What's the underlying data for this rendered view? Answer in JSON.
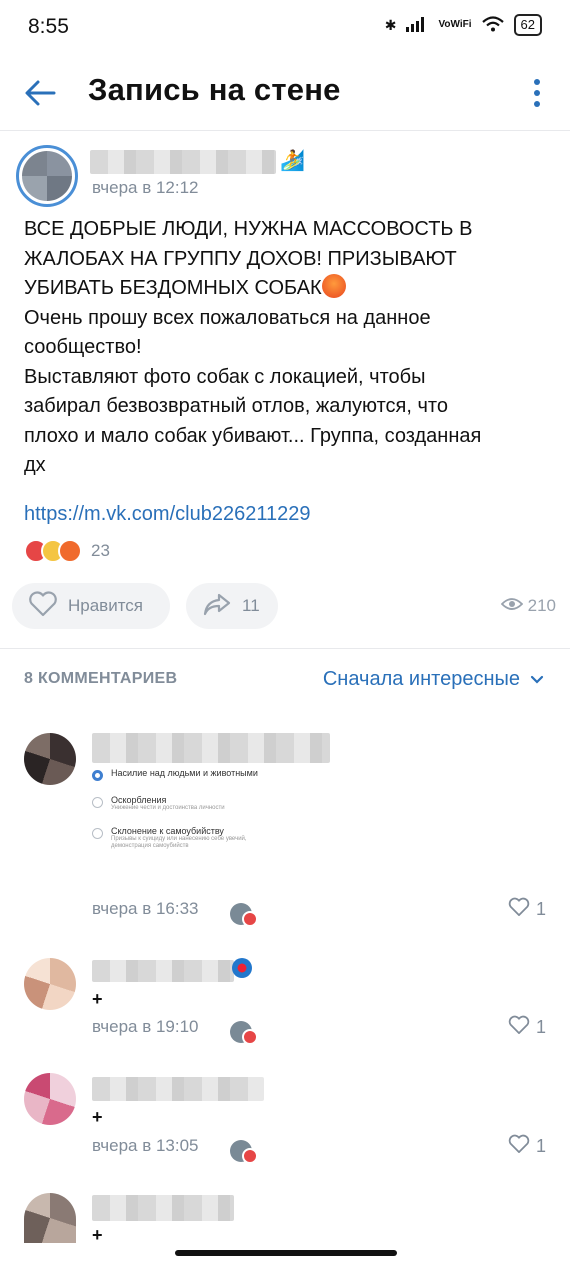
{
  "status_bar": {
    "time": "8:55",
    "network": "VoWiFi",
    "battery": "62"
  },
  "header": {
    "title": "Запись на стене"
  },
  "post": {
    "author_emoji": "🏄",
    "time": "вчера в 12:12",
    "text_lines": [
      "ВСЕ ДОБРЫЕ ЛЮДИ, НУЖНА МАССОВОСТЬ В",
      "ЖАЛОБАХ НА ГРУППУ ДОХОВ! ПРИЗЫВАЮТ",
      "УБИВАТЬ БЕЗДОМНЫХ СОБАК",
      "Очень прошу всех пожаловаться на данное",
      "сообщество!",
      "Выставляют фото собак с локацией, чтобы",
      "забирал безвозвратный отлов, жалуются, что",
      "плохо и мало собак убивают... Группа, созданная",
      "дх"
    ],
    "link": "https://m.vk.com/club226211229",
    "reactions_count": "23",
    "like_label": "Нравится",
    "shares": "11",
    "views": "210"
  },
  "comments_section": {
    "count_label": "8 КОММЕНТАРИЕВ",
    "sort_label": "Сначала интересные",
    "comments": [
      {
        "time": "вчера в 16:33",
        "likes": "1",
        "screenshot_options": [
          {
            "title": "Насилие над людьми и животными",
            "sub": ""
          },
          {
            "title": "Оскорбления",
            "sub": "Унижение чести и достоинства личности"
          },
          {
            "title": "Склонение к самоубийству",
            "sub": "Призывы к суициду или нанесению себе увечий, демонстрация самоубийств"
          }
        ]
      },
      {
        "text": "+",
        "time": "вчера в 19:10",
        "likes": "1"
      },
      {
        "text": "+",
        "time": "вчера в 13:05",
        "likes": "1"
      },
      {
        "text": "+"
      }
    ]
  }
}
